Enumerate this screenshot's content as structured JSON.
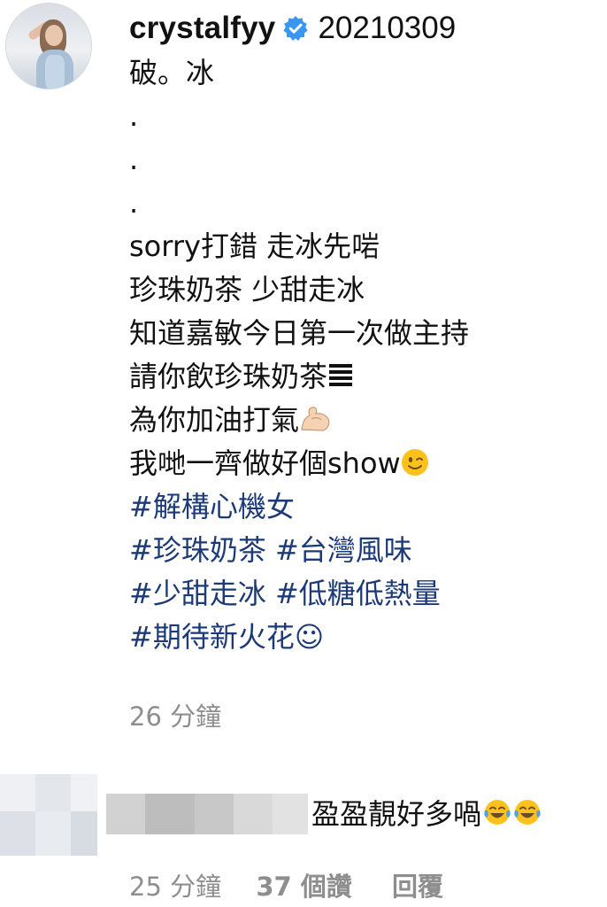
{
  "post": {
    "username": "crystalfyy",
    "date": "20210309",
    "caption_lines": [
      "破。冰",
      ".",
      ".",
      ".",
      "sorry打錯 走冰先啱",
      "珍珠奶茶 少甜走冰",
      "知道嘉敏今日第一次做主持",
      "請你飲珍珠奶茶",
      "為你加油打氣",
      "我哋一齊做好個show"
    ],
    "hashtag_lines": [
      "#解構心機女",
      "#珍珠奶茶 #台灣風味",
      "#少甜走冰 #低糖低熱量",
      "#期待新火花☺"
    ],
    "time_ago": "26 分鐘"
  },
  "reply": {
    "text": "盈盈靚好多喎",
    "time_ago": "25 分鐘",
    "likes": "37 個讚",
    "reply_label": "回覆"
  },
  "colors": {
    "hashtag": "#1d3a78",
    "meta_gray": "#8e8e8e",
    "verified_blue": "#3897f0"
  },
  "icons": {
    "verified": "verified-badge-icon",
    "bars": "trigram-bars-icon",
    "muscle": "flexed-biceps-icon",
    "wink": "winking-face-icon",
    "tears_of_joy": "face-with-tears-of-joy-icon"
  }
}
